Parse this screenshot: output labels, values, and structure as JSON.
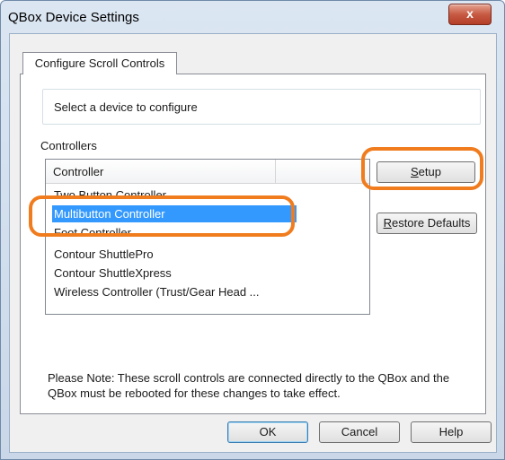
{
  "window": {
    "title": "QBox Device Settings",
    "close_glyph": "x"
  },
  "tabs": [
    {
      "label": "Configure Scroll Controls",
      "active": true
    }
  ],
  "instructions": "Select a device to configure",
  "controllers_group": {
    "label": "Controllers",
    "column_header": "Controller",
    "items": [
      "Two Button Controller",
      "Multibutton Controller",
      "Foot Controller",
      "Contour ShuttlePro",
      "Contour ShuttleXpress",
      "Wireless Controller (Trust/Gear Head ..."
    ],
    "selected_index": 1
  },
  "side_buttons": {
    "setup": {
      "mnemonic": "S",
      "rest": "etup"
    },
    "restore": {
      "mnemonic": "R",
      "rest": "estore Defaults"
    }
  },
  "note": "Please Note: These scroll controls are connected directly to the QBox and the QBox must be rebooted for these changes to take effect.",
  "footer_buttons": {
    "ok": "OK",
    "cancel": "Cancel",
    "help": "Help"
  },
  "colors": {
    "highlight_outline": "#f07c1e",
    "selection": "#3399ff"
  }
}
